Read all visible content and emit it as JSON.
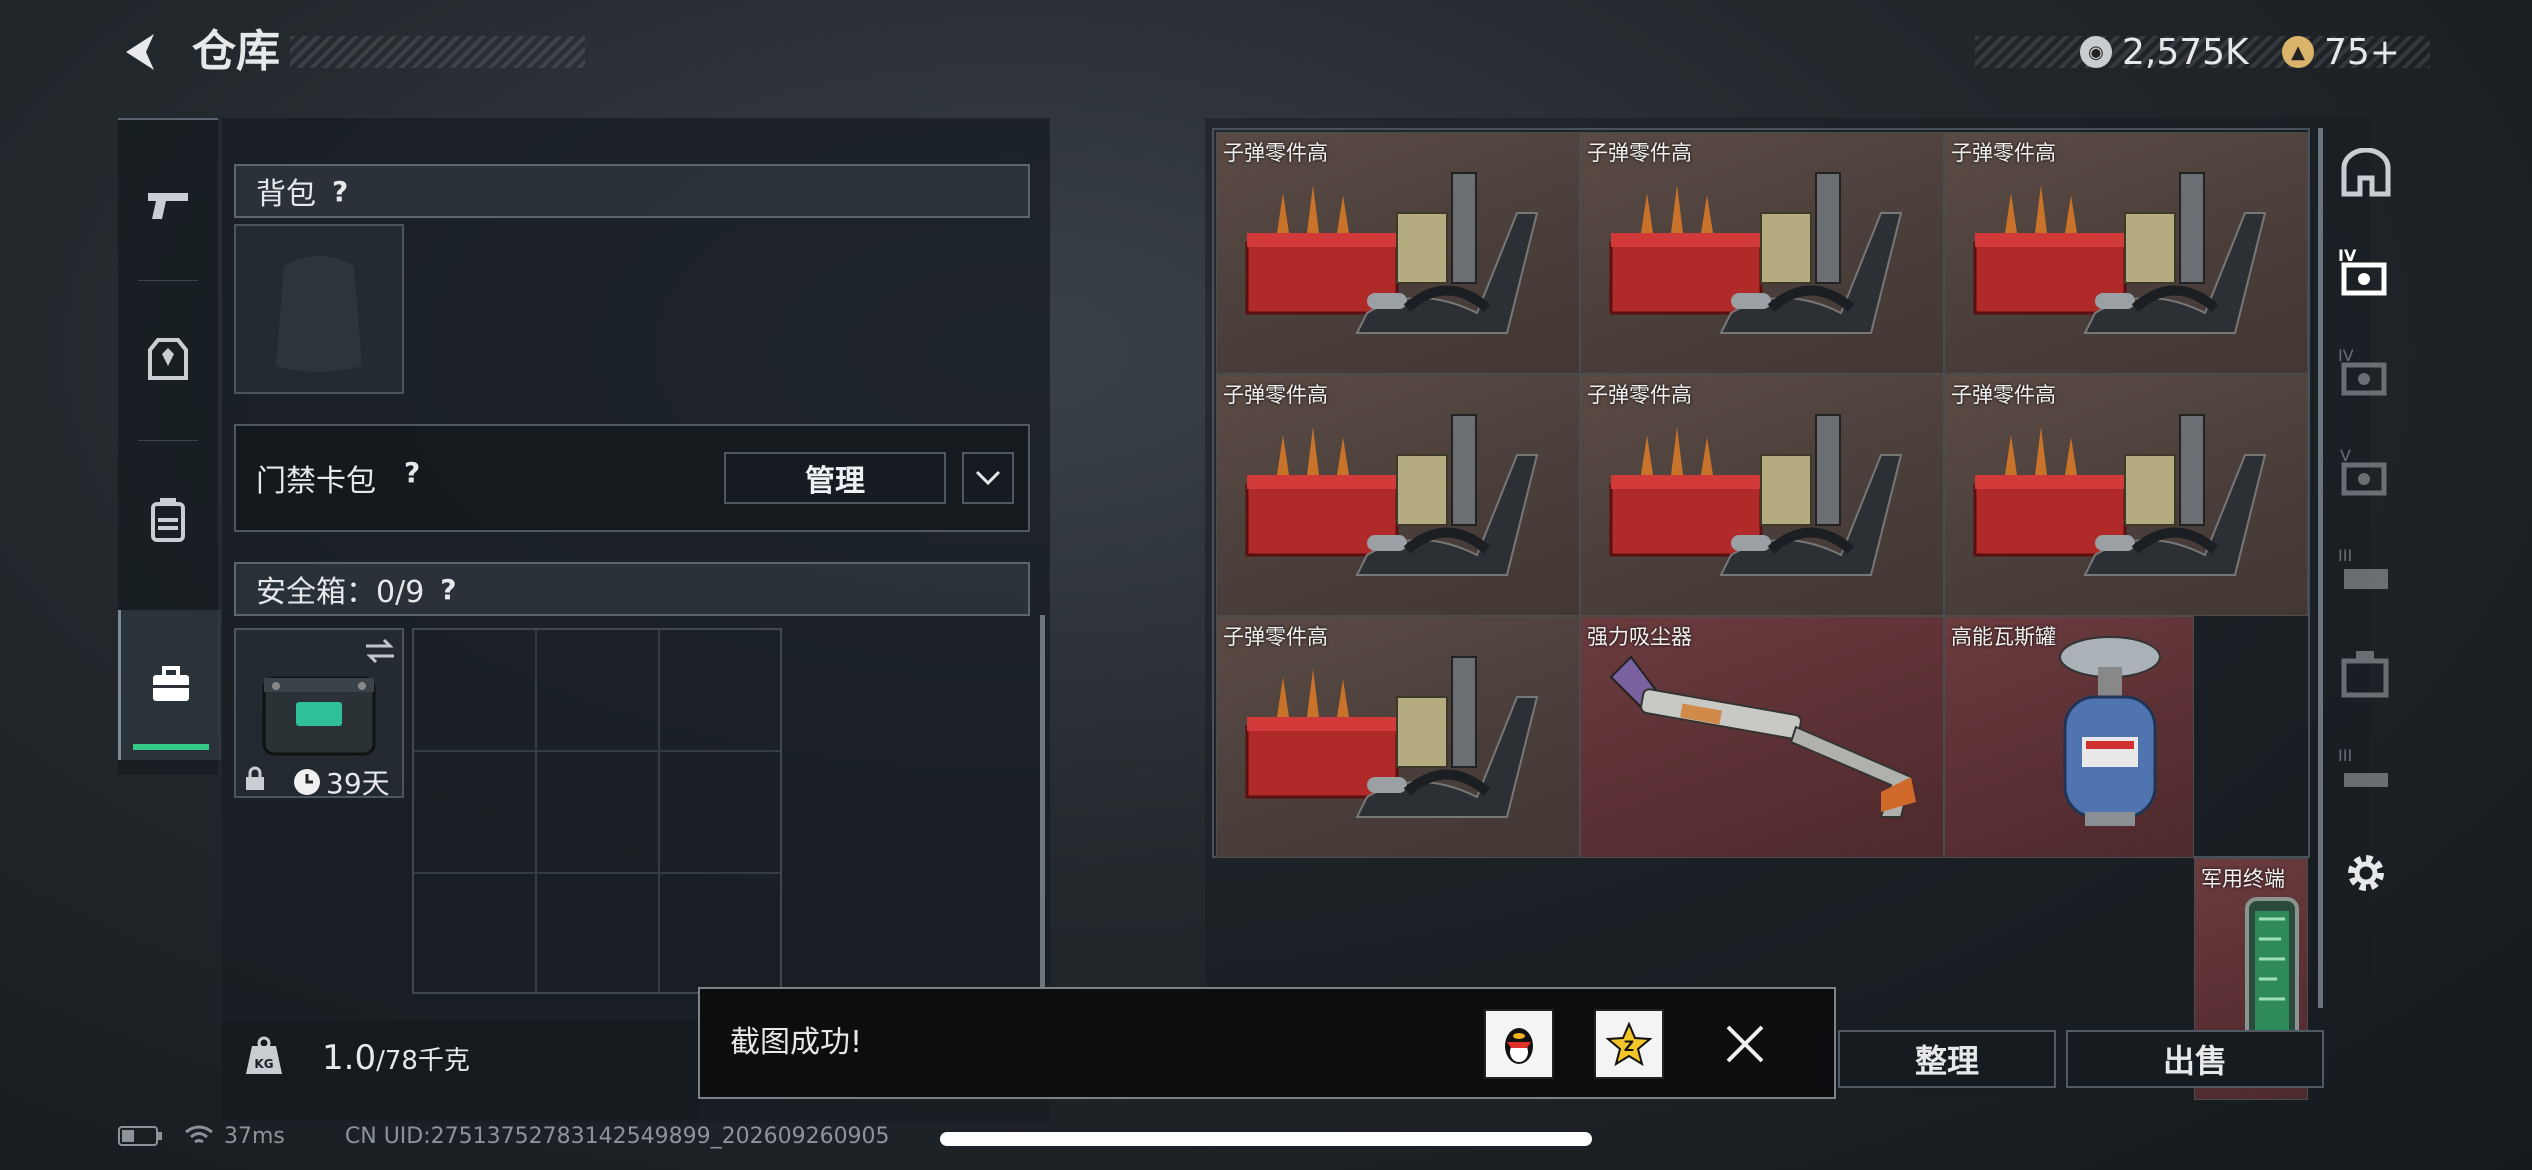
{
  "header": {
    "title": "仓库",
    "silver": "2,575K",
    "gold": "75+"
  },
  "nav": {
    "items": [
      "weapon",
      "armor",
      "backpack",
      "safebox"
    ],
    "active": 3
  },
  "backpack": {
    "label": "背包",
    "help": "?"
  },
  "keycard": {
    "label": "门禁卡包",
    "help": "?",
    "manage": "管理"
  },
  "safebox": {
    "label": "安全箱：0/9",
    "help": "?",
    "days": "39天"
  },
  "weight": {
    "value": "1.0",
    "max": "/78千克",
    "icon_label": "KG"
  },
  "grid": {
    "items": [
      {
        "name": "子弹零件高",
        "kind": "ammo-parts"
      },
      {
        "name": "子弹零件高",
        "kind": "ammo-parts"
      },
      {
        "name": "子弹零件高",
        "kind": "ammo-parts"
      },
      {
        "name": "子弹零件高",
        "kind": "ammo-parts"
      },
      {
        "name": "子弹零件高",
        "kind": "ammo-parts"
      },
      {
        "name": "子弹零件高",
        "kind": "ammo-parts"
      },
      {
        "name": "子弹零件高",
        "kind": "ammo-parts"
      },
      {
        "name": "强力吸尘器",
        "kind": "vacuum"
      },
      {
        "name": "高能瓦斯罐",
        "kind": "gas-tank"
      },
      {
        "name": "军用终端",
        "kind": "terminal"
      }
    ]
  },
  "actions": {
    "sort": "整理",
    "sell": "出售"
  },
  "toast": {
    "text": "截图成功!"
  },
  "status": {
    "ping": "37ms",
    "uid": "CN UID:27513752783142549899_202609260905"
  },
  "colors": {
    "accent_green": "#35c98a",
    "rare_red": "#5a2f33",
    "normal_brown": "#4a3e3a"
  }
}
